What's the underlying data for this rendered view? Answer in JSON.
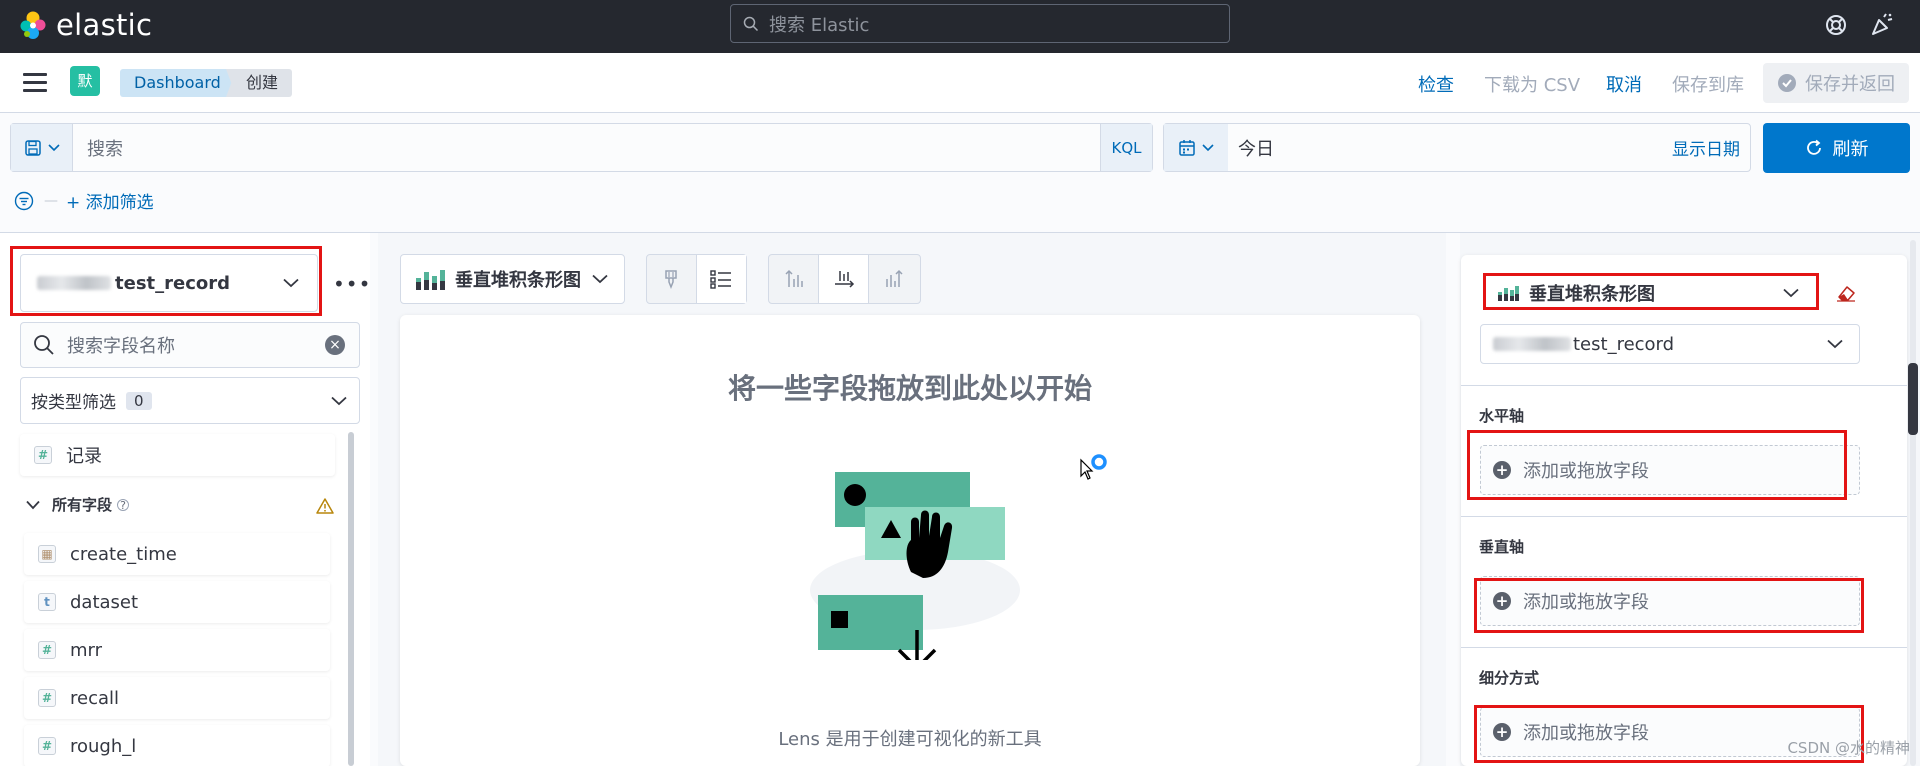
{
  "header": {
    "logo_text": "elastic",
    "search_placeholder": "搜索 Elastic"
  },
  "appbar": {
    "space_initial": "默",
    "breadcrumbs": [
      "Dashboard",
      "创建"
    ],
    "actions": {
      "inspect": "检查",
      "download_csv": "下载为 CSV",
      "cancel": "取消",
      "save_to_library": "保存到库",
      "save_and_return": "保存并返回"
    }
  },
  "query": {
    "placeholder": "搜索",
    "language": "KQL",
    "date_value": "今日",
    "show_dates": "显示日期",
    "refresh": "刷新",
    "add_filter": "+ 添加筛选"
  },
  "left": {
    "index_pattern": "test_record",
    "field_search_placeholder": "搜索字段名称",
    "type_filter_label": "按类型筛选",
    "type_filter_count": "0",
    "record_field": "记录",
    "all_fields_label": "所有字段",
    "fields": [
      {
        "name": "create_time",
        "type": "date"
      },
      {
        "name": "dataset",
        "type": "t"
      },
      {
        "name": "mrr",
        "type": "#"
      },
      {
        "name": "recall",
        "type": "#"
      },
      {
        "name": "rough_l",
        "type": "#"
      }
    ]
  },
  "center": {
    "chart_type": "垂直堆积条形图",
    "drop_title": "将一些字段拖放到此处以开始",
    "drop_subtitle": "Lens 是用于创建可视化的新工具"
  },
  "right": {
    "chart_type": "垂直堆积条形图",
    "index_pattern": "test_record",
    "sections": [
      {
        "label": "水平轴",
        "placeholder": "添加或拖放字段"
      },
      {
        "label": "垂直轴",
        "placeholder": "添加或拖放字段"
      },
      {
        "label": "细分方式",
        "placeholder": "添加或拖放字段"
      }
    ]
  },
  "watermark": "CSDN @水的精神",
  "colors": {
    "accent": "#0077cc",
    "highlight_box": "#e31414",
    "space_badge": "#25bfa3"
  }
}
